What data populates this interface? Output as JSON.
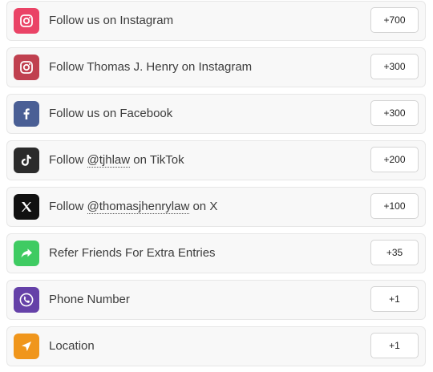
{
  "entries": [
    {
      "pre": "Follow us on Instagram",
      "handle": "",
      "post": "",
      "points": "+700",
      "icon": "instagram-icon",
      "color": "#ea4366"
    },
    {
      "pre": "Follow Thomas J. Henry on Instagram",
      "handle": "",
      "post": "",
      "points": "+300",
      "icon": "instagram-icon",
      "color": "#c0404f"
    },
    {
      "pre": "Follow us on Facebook",
      "handle": "",
      "post": "",
      "points": "+300",
      "icon": "facebook-icon",
      "color": "#4a5f95"
    },
    {
      "pre": "Follow ",
      "handle": "@tjhlaw",
      "post": " on TikTok",
      "points": "+200",
      "icon": "tiktok-icon",
      "color": "#2b2b2b"
    },
    {
      "pre": "Follow ",
      "handle": "@thomasjhenrylaw",
      "post": " on X",
      "points": "+100",
      "icon": "x-icon",
      "color": "#111111"
    },
    {
      "pre": "Refer Friends For Extra Entries",
      "handle": "",
      "post": "",
      "points": "+35",
      "icon": "share-arrow-icon",
      "color": "#3fcb62"
    },
    {
      "pre": "Phone Number",
      "handle": "",
      "post": "",
      "points": "+1",
      "icon": "phone-icon",
      "color": "#6541a8"
    },
    {
      "pre": "Location",
      "handle": "",
      "post": "",
      "points": "+1",
      "icon": "location-arrow-icon",
      "color": "#f0961c"
    }
  ]
}
